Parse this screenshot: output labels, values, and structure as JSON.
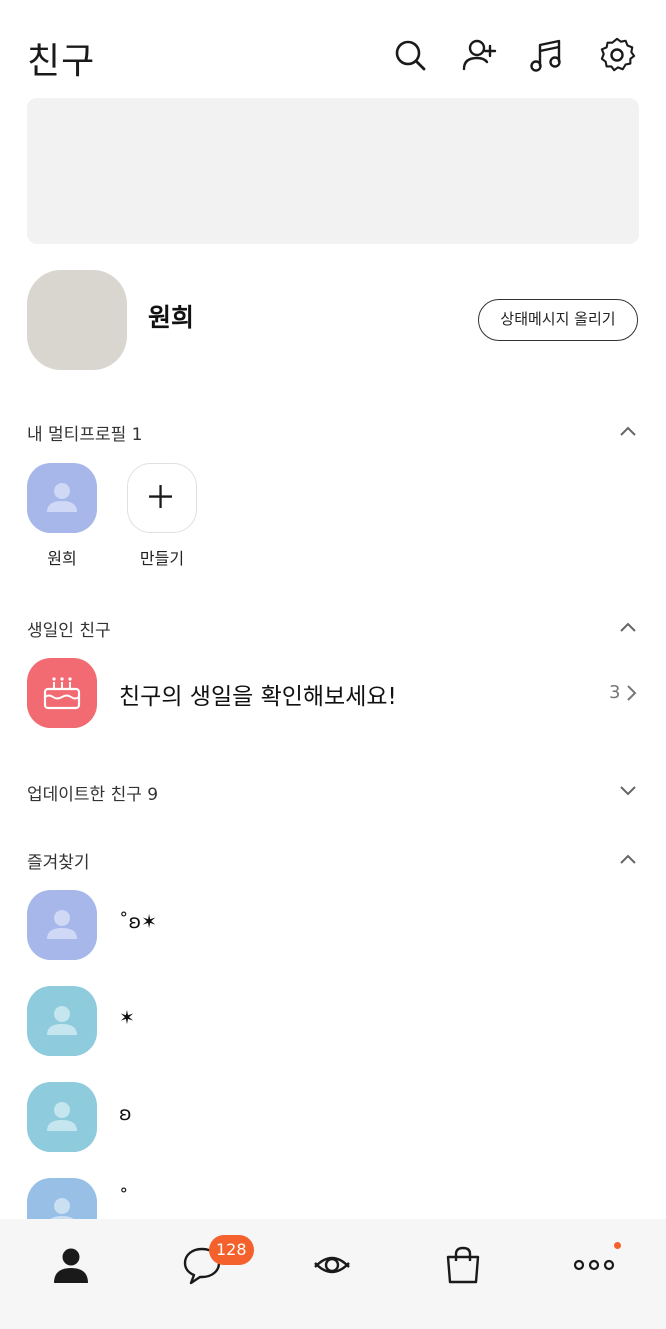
{
  "header": {
    "title": "친구",
    "icons": [
      "search-icon",
      "add-friend-icon",
      "music-icon",
      "settings-icon"
    ]
  },
  "profile": {
    "name": "원희",
    "status_button": "상태메시지 올리기"
  },
  "multiprofile": {
    "section_title": "내 멀티프로필 1",
    "items": [
      {
        "label": "원희",
        "icon": "person-icon"
      },
      {
        "label": "만들기",
        "icon": "plus-icon"
      }
    ]
  },
  "birthday": {
    "section_title": "생일인 친구",
    "message": "친구의 생일을 확인해보세요!",
    "count": "3"
  },
  "updated": {
    "section_title": "업데이트한 친구 9"
  },
  "favorites": {
    "section_title": "즐겨찾기",
    "items": [
      {
        "name": "˚ʚ✶"
      },
      {
        "name": "✶"
      },
      {
        "name": "ʚ"
      },
      {
        "name": "˚"
      }
    ]
  },
  "tabbar": {
    "chat_badge": "128",
    "tabs": [
      "friends-tab-icon",
      "chat-tab-icon",
      "view-tab-icon",
      "shopping-tab-icon",
      "more-tab-icon"
    ]
  },
  "colors": {
    "accent": "#f4612c",
    "birthday": "#f26a72",
    "avatar_purple": "#a7b7ea",
    "avatar_teal": "#8ecbdc",
    "avatar_blue": "#98bfe6",
    "my_avatar": "#d9d6cf",
    "banner": "#f2f2f2"
  }
}
